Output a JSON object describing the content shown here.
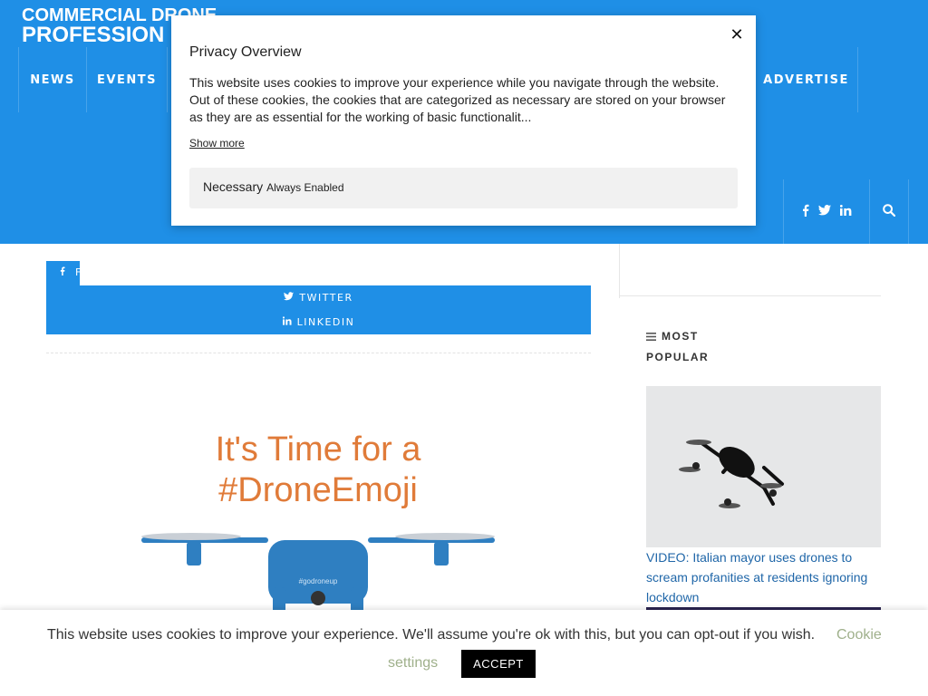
{
  "header": {
    "logo_line1": "COMMERCIAL DRONE",
    "logo_line2": "PROFESSION",
    "nav": {
      "news": "NEWS",
      "events": "EVENTS",
      "advertise": "ADVERTISE"
    }
  },
  "share": {
    "facebook": "FACEBOOK",
    "twitter": "TWITTER",
    "linkedin": "LINKEDIN"
  },
  "article": {
    "image_line1": "It's Time for a",
    "image_line2": "#DroneEmoji",
    "image_tag": "#godroneup"
  },
  "sidebar": {
    "most_popular_1": "MOST",
    "most_popular_2": "POPULAR",
    "popular_title": "VIDEO: Italian mayor uses drones to scream profanities at residents ignoring lockdown"
  },
  "modal": {
    "title": "Privacy Overview",
    "text": "This website uses cookies to improve your experience while you navigate through the website. Out of these cookies, the cookies that are categorized as necessary are stored on your browser as they are as essential for the working of basic functionalit...",
    "show_more": "Show more",
    "necessary": "Necessary",
    "always_enabled": "Always Enabled",
    "close": "✕"
  },
  "cookie_bar": {
    "text": "This website uses cookies to improve your experience. We'll assume you're ok with this, but you can opt-out if you wish.",
    "settings_part1": "Cookie",
    "settings_part2": "settings",
    "accept": "ACCEPT"
  },
  "colors": {
    "brand_blue": "#1f8fe6",
    "link_blue": "#1f66a8",
    "emoji_orange": "#e07b39",
    "drone_blue": "#2f7fc1",
    "settings_green": "#9fb08b"
  }
}
